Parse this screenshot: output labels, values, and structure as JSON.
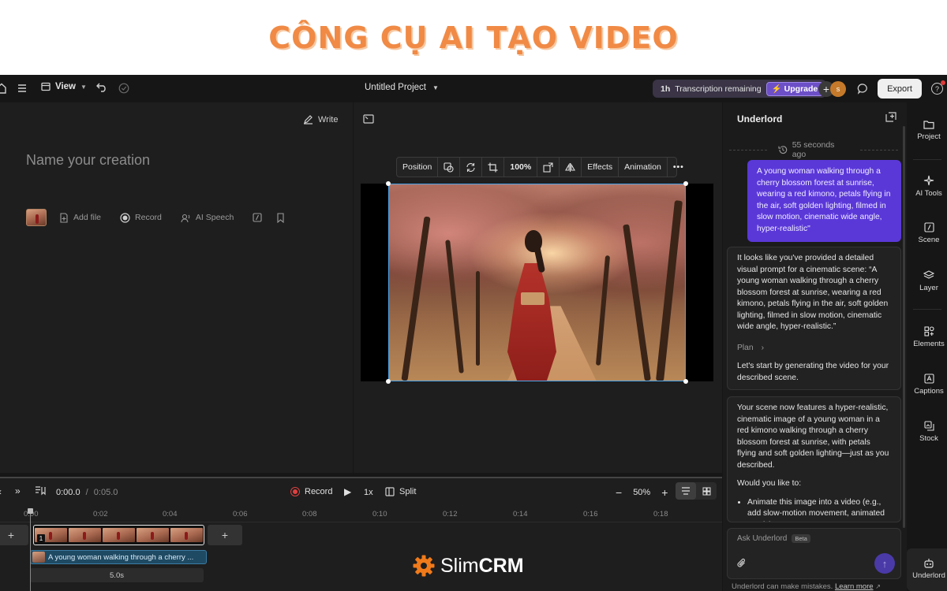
{
  "banner": {
    "title": "CÔNG CỤ AI TẠO VIDEO"
  },
  "topbar": {
    "view_label": "View",
    "project_title": "Untitled Project",
    "transcription_amount": "1h",
    "transcription_label": "Transcription remaining",
    "upgrade_label": "Upgrade",
    "avatar_initial": "s",
    "export_label": "Export",
    "help_label": "?"
  },
  "editor": {
    "write_label": "Write",
    "name_placeholder": "Name your creation",
    "add_file_label": "Add file",
    "record_label": "Record",
    "ai_speech_label": "AI Speech"
  },
  "canvas_toolbar": {
    "position_label": "Position",
    "zoom_value": "100%",
    "effects_label": "Effects",
    "animation_label": "Animation"
  },
  "timeline": {
    "current_time": "0:00.0",
    "separator": "/",
    "total_time": "0:05.0",
    "record_label": "Record",
    "speed_label": "1x",
    "split_label": "Split",
    "zoom_level": "50%",
    "ruler_ticks": [
      "0:00",
      "0:02",
      "0:04",
      "0:06",
      "0:08",
      "0:10",
      "0:12",
      "0:14",
      "0:16",
      "0:18"
    ],
    "clip_badge": "1",
    "caption_text": "A young woman walking through a cherry ...",
    "clip_duration": "5.0s"
  },
  "watermark": {
    "brand_light": "Slim",
    "brand_bold": "CRM"
  },
  "chat": {
    "title": "Underlord",
    "timestamp": "55 seconds ago",
    "user_message": "A young woman walking through a cherry blossom forest at sunrise, wearing a red kimono, petals flying in the air, soft golden lighting, filmed in slow motion, cinematic wide angle, hyper-realistic\"",
    "ai_message_1": "It looks like you've provided a detailed visual prompt for a cinematic scene: “A young woman walking through a cherry blossom forest at sunrise, wearing a red kimono, petals flying in the air, soft golden lighting, filmed in slow motion, cinematic wide angle, hyper-realistic.”",
    "plan_label": "Plan",
    "ai_message_1_end": "Let's start by generating the video for your described scene.",
    "ai_message_2": "Your scene now features a hyper-realistic, cinematic image of a young woman in a red kimono walking through a cherry blossom forest at sunrise, with petals flying and soft golden lighting—just as you described.",
    "ai_question": "Would you like to:",
    "ai_option_1": "Animate this image into a video (e.g., add slow-motion movement, animated petals)?",
    "input_placeholder": "Ask Underlord",
    "beta_label": "Beta",
    "disclaimer": "Underlord can make mistakes.",
    "learn_more": "Learn more"
  },
  "rail": {
    "items": [
      {
        "label": "Project",
        "icon": "folder-icon"
      },
      {
        "label": "AI Tools",
        "icon": "sparkle-icon"
      },
      {
        "label": "Scene",
        "icon": "scene-icon"
      },
      {
        "label": "Layer",
        "icon": "layers-icon"
      },
      {
        "label": "Elements",
        "icon": "elements-icon"
      },
      {
        "label": "Captions",
        "icon": "captions-icon"
      },
      {
        "label": "Stock",
        "icon": "stock-icon"
      },
      {
        "label": "Underlord",
        "icon": "robot-icon"
      }
    ]
  },
  "colors": {
    "accent": "#5a38d8",
    "banner": "#f08a45",
    "selection": "#4aa3e8",
    "record": "#e04040"
  }
}
